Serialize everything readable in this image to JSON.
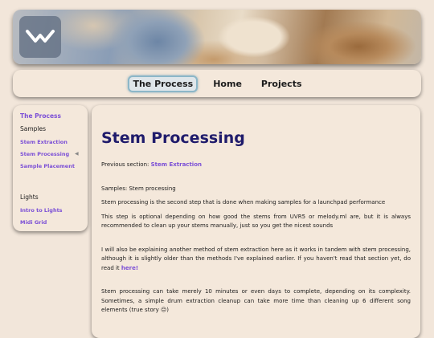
{
  "nav": {
    "items": [
      {
        "label": "The Process"
      },
      {
        "label": "Home"
      },
      {
        "label": "Projects"
      }
    ]
  },
  "sidebar": {
    "title": "The Process",
    "sections": [
      {
        "heading": "Samples",
        "links": [
          "Stem Extraction",
          "Stem Processing",
          "Sample Placement"
        ]
      },
      {
        "heading": "Lights",
        "links": [
          "Intro to Lights",
          "Midi Grid"
        ]
      }
    ],
    "current": "Stem Processing"
  },
  "main": {
    "title": "Stem Processing",
    "prev_prefix": "Previous section:",
    "prev_link": "Stem Extraction",
    "breadcrumb": "Samples: Stem processing",
    "p1": "Stem processing is the second step that is done when making samples for a launchpad performance",
    "p2": "This step is optional depending on how good the stems from UVR5 or melody.ml are, but it is always recommended to clean up your stems manually, just so you get the nicest sounds",
    "p3": "I will also be explaining another method of stem extraction here as it works in tandem with stem processing, although it is slightly older than the methods I've explained earlier. If you haven't read that section yet, do read it",
    "p3_link": "here!",
    "p4": "Stem processing can take merely 10 minutes or even days to complete, depending on its complexity. Sometimes, a simple drum extraction cleanup can take more time than cleaning up 6 different song elements (true story 😔)"
  },
  "icons": {
    "logo": "chevron-down-logo-icon",
    "current_indicator": "triangle-left-icon"
  },
  "colors": {
    "accent": "#7b4fd6",
    "title": "#1f1b6b",
    "background": "#f2e6da"
  }
}
